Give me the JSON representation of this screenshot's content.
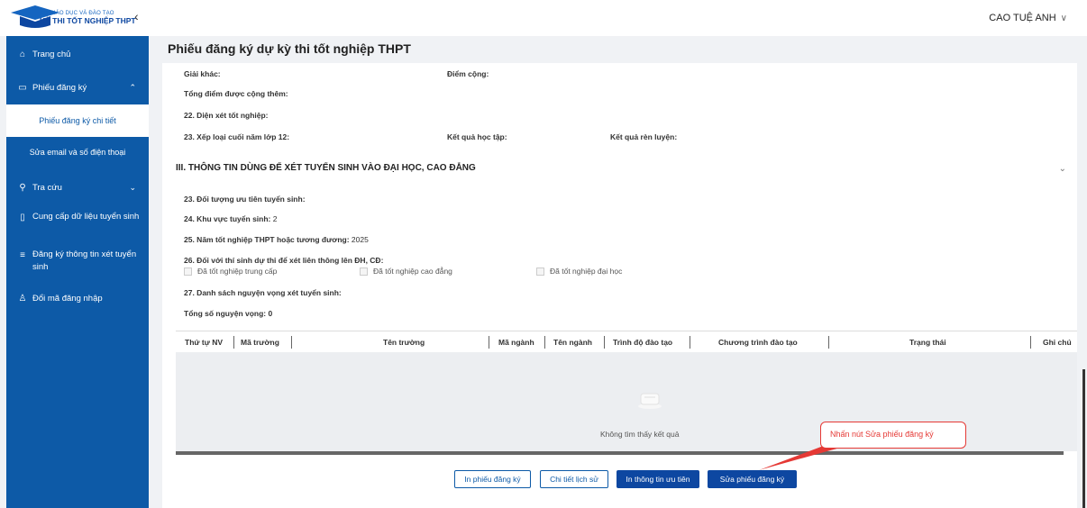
{
  "header": {
    "logo_small": "BỘ GIÁO DỤC VÀ ĐÀO TẠO",
    "logo_big": "KỲ THI TỐT NGHIỆP THPT",
    "collapse_glyph": "‹",
    "user_name": "CAO TUỆ ANH",
    "user_chevron": "∨"
  },
  "sidebar": {
    "home": "Trang chủ",
    "registration": "Phiếu đăng ký",
    "registration_detail": "Phiếu đăng ký chi tiết",
    "edit_contact": "Sửa email và số điện thoại",
    "lookup": "Tra cứu",
    "provide_data": "Cung cấp dữ liệu tuyển sinh",
    "register_admission": "Đăng ký thông tin xét tuyển sinh",
    "change_password": "Đổi mã đăng nhập"
  },
  "page": {
    "title": "Phiếu đăng ký dự kỳ thi tốt nghiệp THPT"
  },
  "form": {
    "other_award": "Giải khác:",
    "bonus_point": "Điểm cộng:",
    "total_bonus": "Tổng điểm được cộng thêm:",
    "q22": "22. Diện xét tốt nghiệp:",
    "q23_grade": "23. Xếp loại cuối năm lớp 12:",
    "study_result": "Kết quả học tập:",
    "conduct_result": "Kết quả rèn luyện:",
    "section3": "III. THÔNG TIN DÙNG ĐỂ XÉT TUYỂN SINH VÀO ĐẠI HỌC, CAO ĐẲNG",
    "q23_priority": "23. Đối tượng ưu tiên tuyển sinh:",
    "q24_label": "24. Khu vực tuyển sinh:",
    "q24_value": " 2",
    "q25_label": "25. Năm tốt nghiệp THPT hoặc tương đương:",
    "q25_value": " 2025",
    "q26": "26. Đối với thí sinh dự thi để xét liên thông lên ĐH, CĐ:",
    "cb1": "Đã tốt nghiệp trung cấp",
    "cb2": "Đã tốt nghiệp cao đẳng",
    "cb3": "Đã tốt nghiệp đại học",
    "q27": "27. Danh sách nguyện vọng xét tuyển sinh:",
    "total_wishes_label": "Tổng số nguyện vọng:",
    "total_wishes_value": " 0"
  },
  "table": {
    "columns": [
      "Thứ tự NV",
      "Mã trường",
      "Tên trường",
      "Mã ngành",
      "Tên ngành",
      "Trình độ đào tạo",
      "Chương trình đào tạo",
      "Trạng thái",
      "Ghi chú"
    ],
    "empty_text": "Không tìm thấy kết quả"
  },
  "buttons": {
    "print": "In phiếu đăng ký",
    "history": "Chi tiết lịch sử",
    "print_priority": "In thông tin ưu tiên",
    "edit": "Sửa phiếu đăng ký"
  },
  "annotation": {
    "text": "Nhấn nút Sửa phiếu đăng ký",
    "color": "#e53935"
  },
  "colors": {
    "sidebar": "#0d5aa7",
    "primary_button": "#0d47a1"
  }
}
